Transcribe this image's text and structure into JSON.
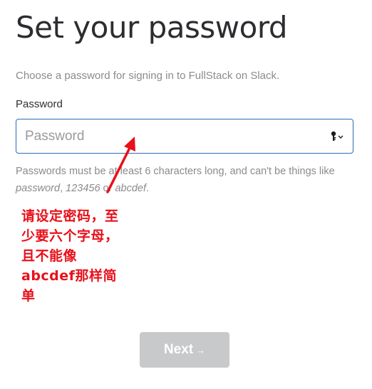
{
  "page": {
    "title": "Set your password",
    "subtitle": "Choose a password for signing in to FullStack on Slack."
  },
  "password_field": {
    "label": "Password",
    "placeholder": "Password",
    "value": "",
    "icon": "password-key-icon"
  },
  "help": {
    "prefix": "Passwords must be at least 6 characters long, and can't be things like ",
    "example_1": "password",
    "sep_1": ", ",
    "example_2": "123456",
    "sep_2": " or ",
    "example_3": "abcdef",
    "suffix": "."
  },
  "annotation": {
    "lines": [
      "请设定密码，至",
      "少要六个字母，",
      "且不能像",
      "abcdef那样简",
      "单"
    ],
    "color": "#e8101a"
  },
  "actions": {
    "next_label": "Next",
    "next_arrow": "→",
    "next_bg": "#c8c9cb"
  }
}
